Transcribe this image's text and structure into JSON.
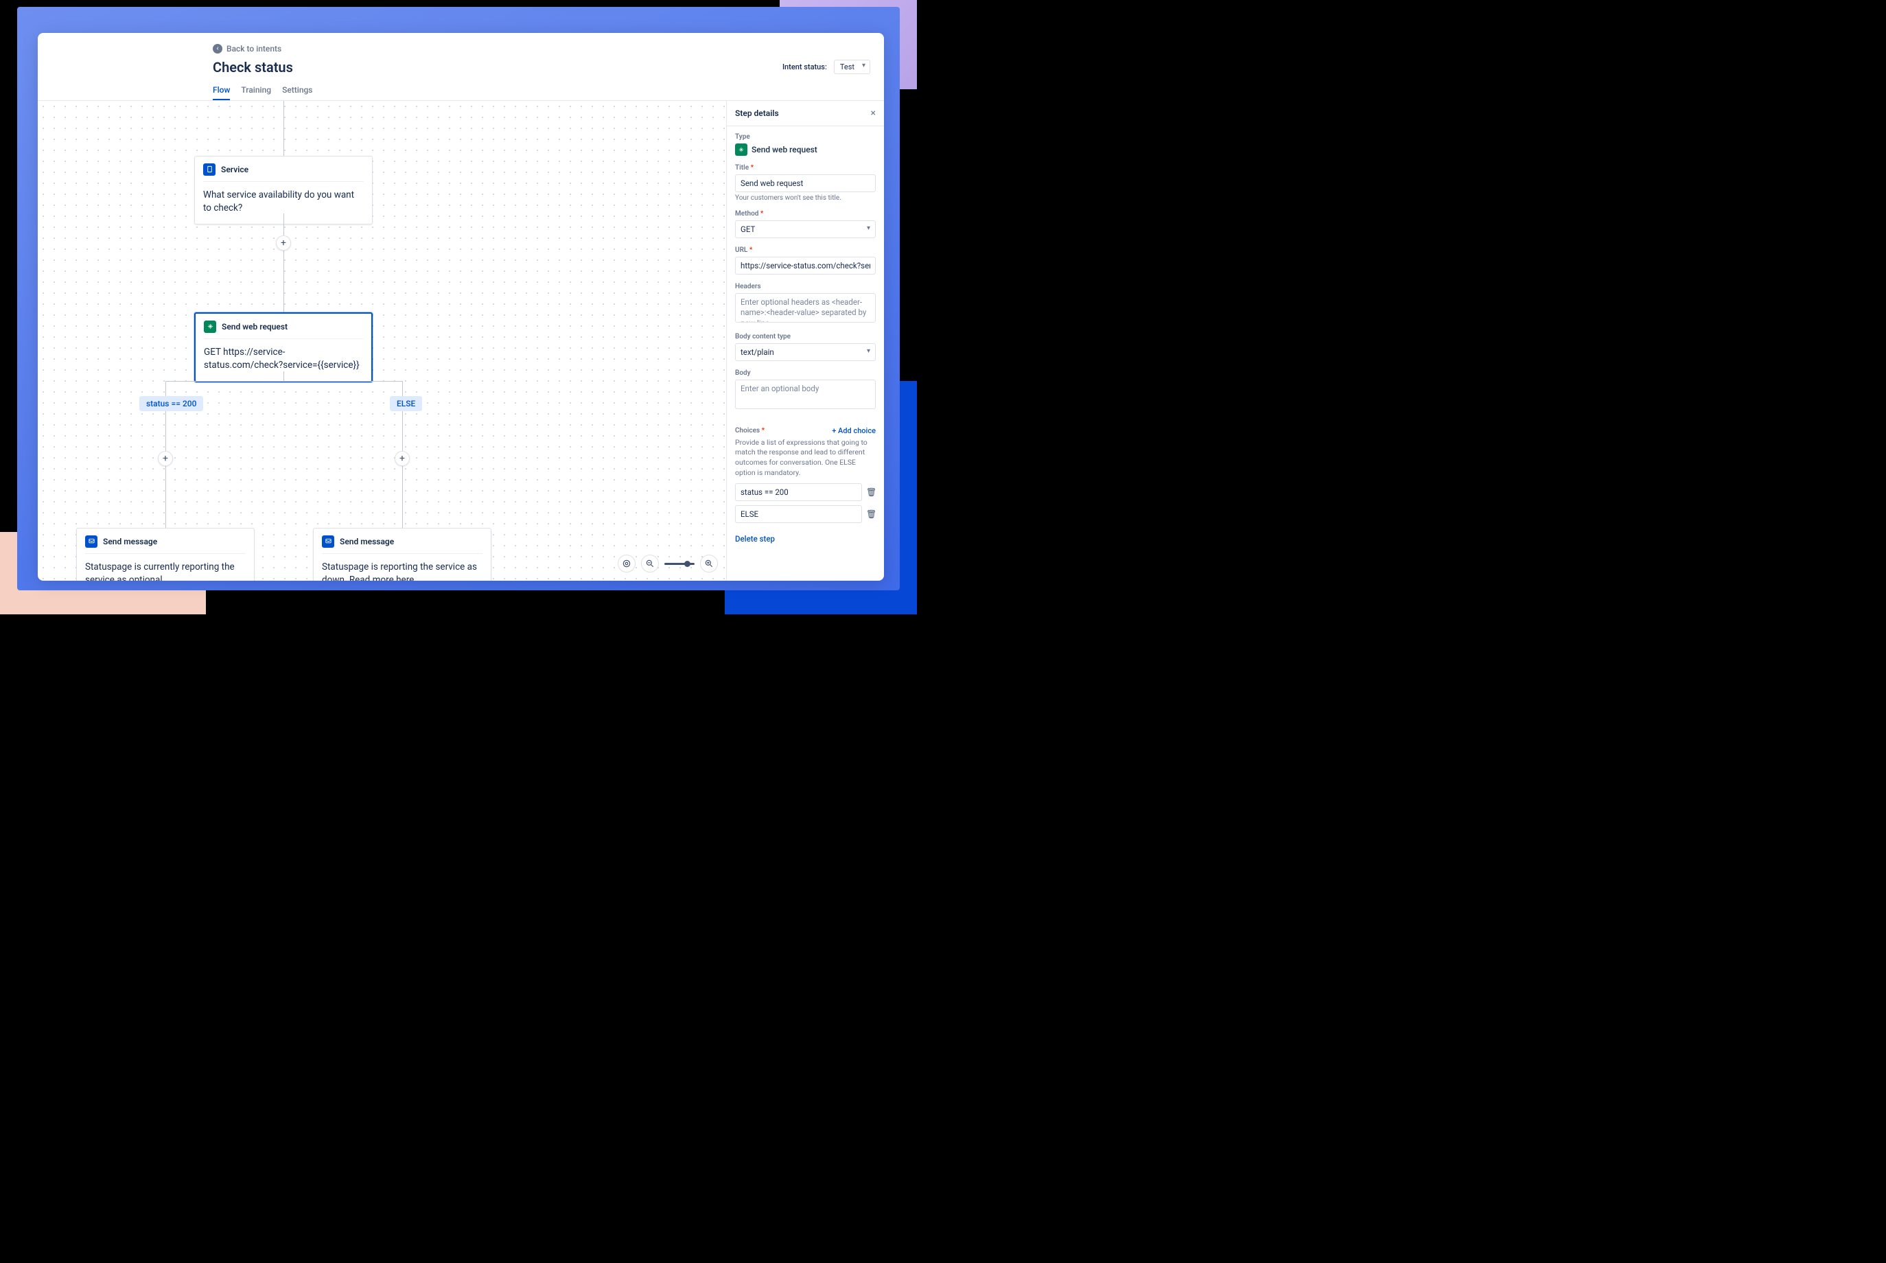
{
  "header": {
    "back_label": "Back to intents",
    "title": "Check status",
    "intent_status_label": "Intent status:",
    "intent_status_value": "Test",
    "tabs": [
      "Flow",
      "Training",
      "Settings"
    ],
    "active_tab": 0
  },
  "flow": {
    "service_node": {
      "title": "Service",
      "body": "What service availability do you want to check?"
    },
    "webreq_node": {
      "title": "Send web request",
      "body": "GET https://service-status.com/check?service={{service}}"
    },
    "branch_left": "status == 200",
    "branch_right": "ELSE",
    "msg_left": {
      "title": "Send message",
      "body": "Statuspage is currently reporting the service as optional."
    },
    "msg_right": {
      "title": "Send message",
      "body": "Statuspage is reporting the service as down. Read more here."
    }
  },
  "panel": {
    "title": "Step details",
    "type_label": "Type",
    "type_value": "Send web request",
    "title_field_label": "Title",
    "title_field_value": "Send web request",
    "title_help": "Your customers won't see this title.",
    "method_label": "Method",
    "method_value": "GET",
    "url_label": "URL",
    "url_value": "https://service-status.com/check?service={{service}}",
    "headers_label": "Headers",
    "headers_placeholder": "Enter optional headers as <header-name>:<header-value> separated by new line",
    "bodytype_label": "Body content type",
    "bodytype_value": "text/plain",
    "body_label": "Body",
    "body_placeholder": "Enter an optional body",
    "choices_label": "Choices",
    "add_choice": "+  Add choice",
    "choices_desc": "Provide a list of expressions that going to match the response and lead to different outcomes for conversation. One ELSE option is mandatory.",
    "choices": [
      "status == 200",
      "ELSE"
    ],
    "delete_step": "Delete step"
  }
}
